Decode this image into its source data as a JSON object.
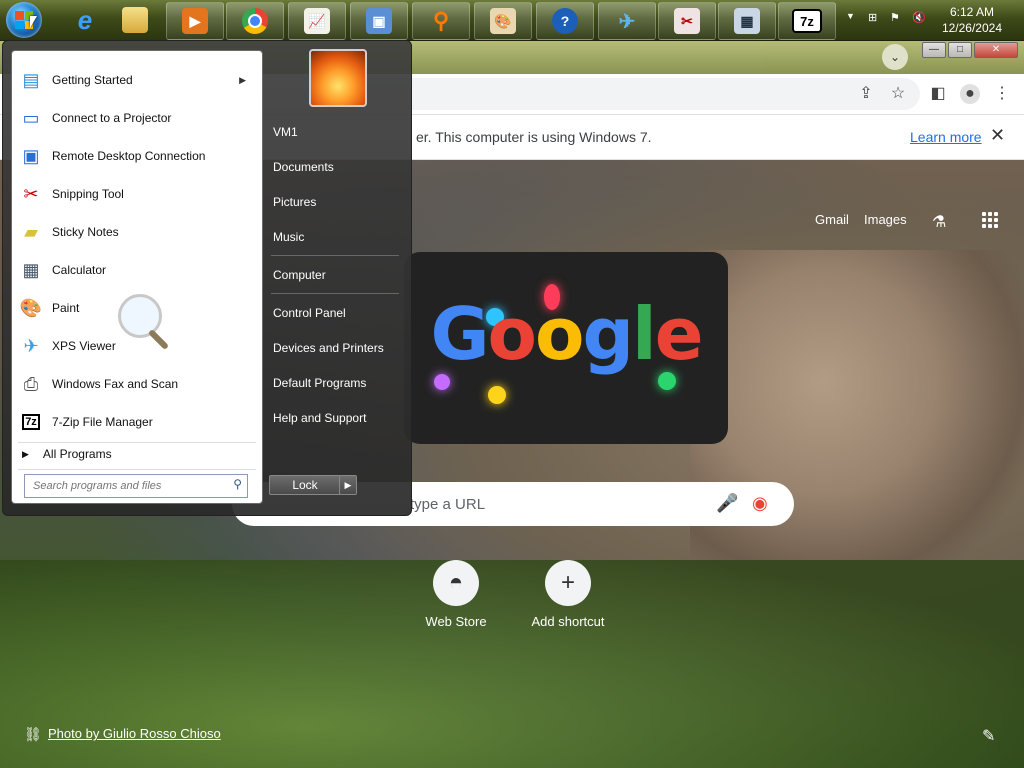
{
  "taskbar": {
    "apps": [
      {
        "name": "internet-explorer-icon"
      },
      {
        "name": "file-explorer-icon"
      },
      {
        "name": "media-player-icon"
      },
      {
        "name": "chrome-icon"
      },
      {
        "name": "chart-app-icon"
      },
      {
        "name": "remote-desktop-icon"
      },
      {
        "name": "search-magnifier-icon"
      },
      {
        "name": "paint-icon"
      },
      {
        "name": "help-icon"
      },
      {
        "name": "xps-viewer-icon"
      },
      {
        "name": "snipping-tool-icon"
      },
      {
        "name": "calculator-icon"
      },
      {
        "name": "7zip-icon"
      }
    ],
    "zip_label": "7z",
    "help_label": "?",
    "clock_time": "6:12 AM",
    "clock_date": "12/26/2024"
  },
  "chrome": {
    "infobar_message": "er. This computer is using Windows 7.",
    "infobar_link": "Learn more",
    "gmail": "Gmail",
    "images": "Images",
    "doodle_text": "Google",
    "search_placeholder": "type a URL",
    "shortcuts": [
      {
        "label": "Web Store"
      },
      {
        "label": "Add shortcut"
      }
    ],
    "photo_credit": "Photo by Giulio Rosso Chioso"
  },
  "start_menu": {
    "programs": [
      {
        "label": "Getting Started",
        "icon": "getting-started-icon",
        "has_submenu": true
      },
      {
        "label": "Connect to a Projector",
        "icon": "projector-icon"
      },
      {
        "label": "Remote Desktop Connection",
        "icon": "remote-desktop-icon"
      },
      {
        "label": "Snipping Tool",
        "icon": "scissors-icon"
      },
      {
        "label": "Sticky Notes",
        "icon": "sticky-notes-icon"
      },
      {
        "label": "Calculator",
        "icon": "calculator-icon"
      },
      {
        "label": "Paint",
        "icon": "paint-palette-icon"
      },
      {
        "label": "XPS Viewer",
        "icon": "xps-viewer-icon"
      },
      {
        "label": "Windows Fax and Scan",
        "icon": "fax-icon"
      },
      {
        "label": "7-Zip File Manager",
        "icon": "7zip-icon"
      }
    ],
    "all_programs": "All Programs",
    "search_placeholder": "Search programs and files",
    "right_items": [
      {
        "label": "VM1"
      },
      {
        "label": "Documents"
      },
      {
        "label": "Pictures"
      },
      {
        "label": "Music"
      },
      {
        "label": "Computer"
      },
      {
        "label": "Control Panel"
      },
      {
        "label": "Devices and Printers"
      },
      {
        "label": "Default Programs"
      },
      {
        "label": "Help and Support"
      }
    ],
    "lock_label": "Lock"
  }
}
